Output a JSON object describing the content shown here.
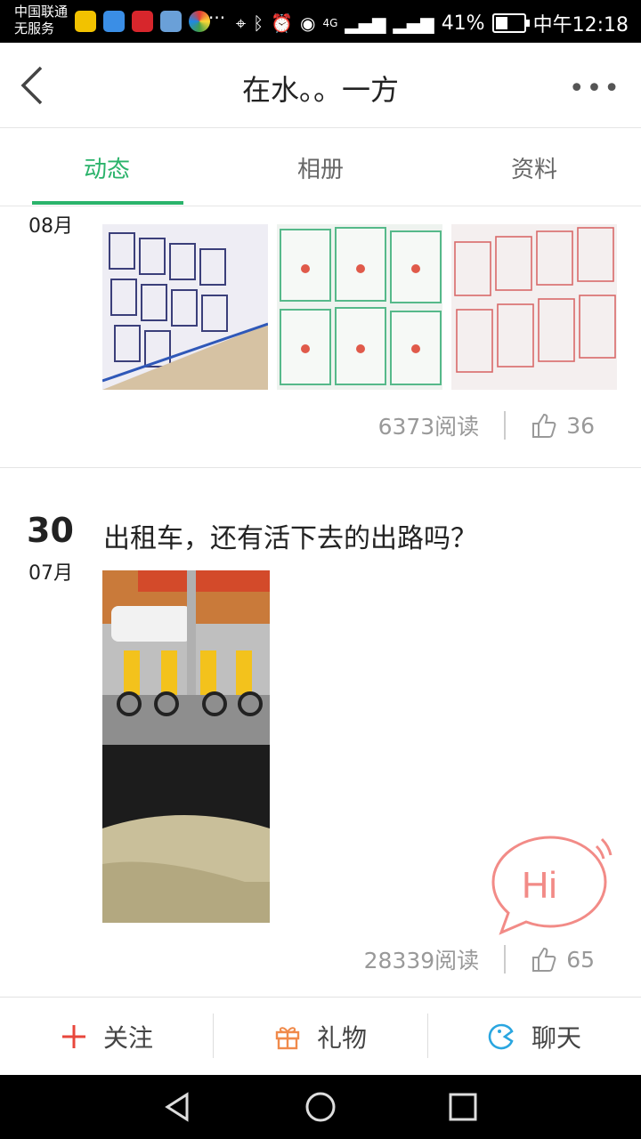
{
  "status_bar": {
    "carrier_line1": "中国联通",
    "carrier_line2": "无服务",
    "more_dots": "···",
    "network": "4G",
    "battery": "41%",
    "time": "中午12:18"
  },
  "header": {
    "title": "在水。。一方",
    "more_label": "•••"
  },
  "tabs": [
    {
      "label": "动态",
      "active": true
    },
    {
      "label": "相册",
      "active": false
    },
    {
      "label": "资料",
      "active": false
    }
  ],
  "posts": [
    {
      "day": "",
      "month": "08月",
      "title": "",
      "reads": "6373阅读",
      "likes": "36"
    },
    {
      "day": "30",
      "month": "07月",
      "title": "出租车，还有活下去的出路吗？",
      "reads": "28339阅读",
      "likes": "65"
    }
  ],
  "hi_bubble": {
    "label": "Hi"
  },
  "actions": [
    {
      "label": "关注",
      "icon": "plus-icon",
      "color": "#e8473c"
    },
    {
      "label": "礼物",
      "icon": "gift-icon",
      "color": "#f08a4b"
    },
    {
      "label": "聊天",
      "icon": "chat-icon",
      "color": "#2aa6e0"
    }
  ],
  "colors": {
    "accent": "#2bb36b",
    "hi_bubble": "#f28b87"
  }
}
